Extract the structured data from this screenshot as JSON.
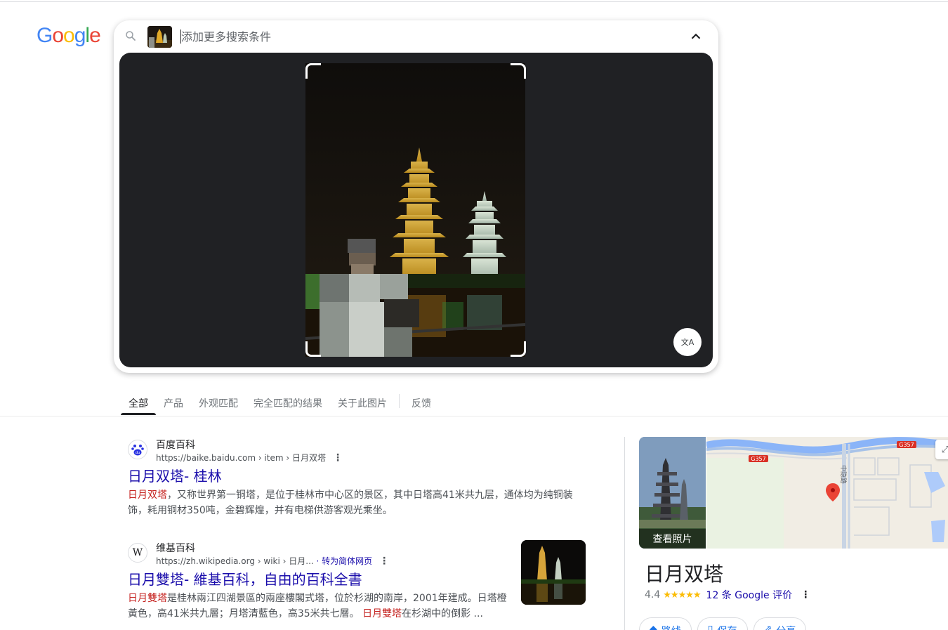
{
  "logo": {
    "letters": [
      "G",
      "o",
      "o",
      "g",
      "l",
      "e"
    ],
    "colors": [
      "#4285F4",
      "#EA4335",
      "#FBBC05",
      "#4285F4",
      "#34A853",
      "#EA4335"
    ]
  },
  "search": {
    "placeholder": "添加更多搜索条件",
    "value": ""
  },
  "lens": {
    "translate_icon": "文A"
  },
  "tabs": [
    "全部",
    "产品",
    "外观匹配",
    "完全匹配的结果",
    "关于此图片",
    "反馈"
  ],
  "results": [
    {
      "site_name": "百度百科",
      "url": "https://baike.baidu.com › item › 日月双塔",
      "title": "日月双塔- 桂林",
      "snippet_hl": "日月双塔",
      "snippet_rest": "，又称世界第一铜塔，是位于桂林市中心区的景区，其中日塔高41米共九层，通体均为纯铜装饰，耗用铜材350吨，金碧辉煌，并有电梯供游客观光乘坐。"
    },
    {
      "site_name": "维基百科",
      "url": "https://zh.wikipedia.org › wiki › 日月...",
      "translate": "· 转为简体网页",
      "title": "日月雙塔- 維基百科，自由的百科全書",
      "snippet_hl": "日月雙塔",
      "snippet_rest": "是桂林兩江四湖景區的兩座樓閣式塔，位於杉湖的南岸，2001年建成。日塔橙黃色，高41米共九層；月塔清藍色，高35米共七層。",
      "snippet_hl2": "日月雙塔",
      "snippet_rest2": "在杉湖中的倒影 ..."
    }
  ],
  "knowledge_panel": {
    "photo_label": "查看照片",
    "map_labels": [
      "G357",
      "G357",
      "中隐路"
    ],
    "title": "日月双塔",
    "rating": "4.4",
    "stars": "★★★★★",
    "reviews": "12 条 Google 评价",
    "actions": [
      "路线",
      "保存",
      "分享"
    ]
  }
}
